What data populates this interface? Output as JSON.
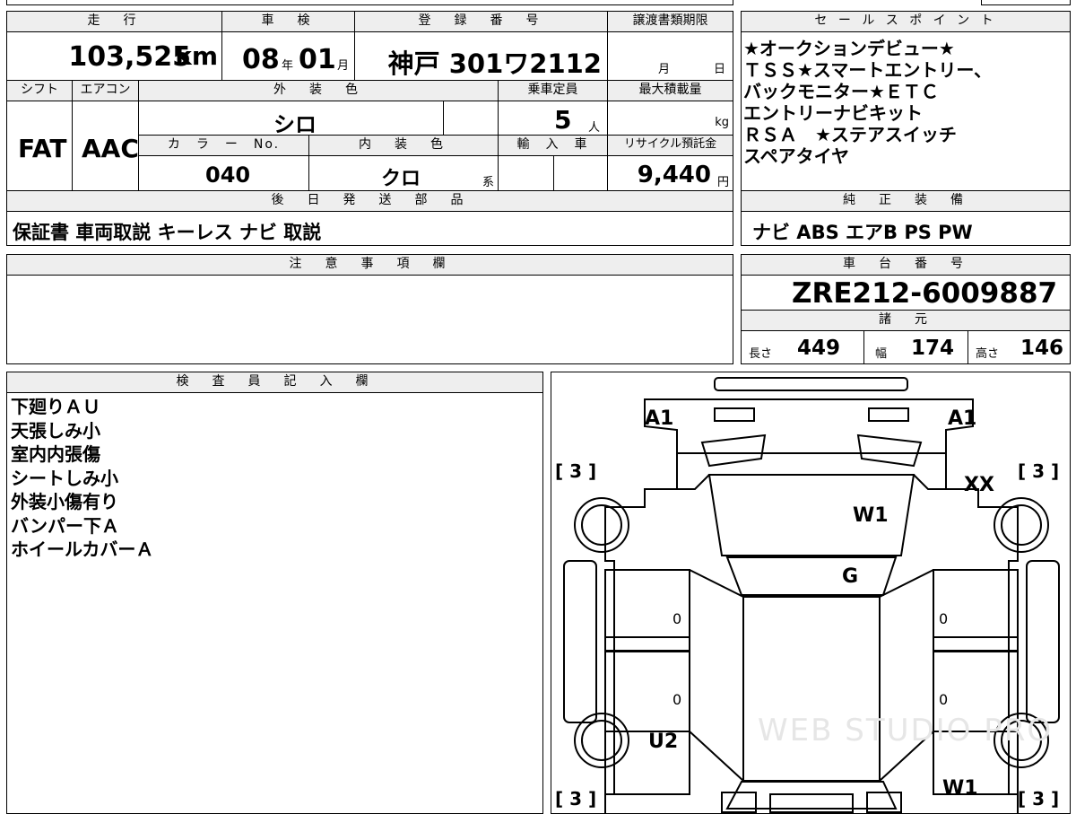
{
  "top_info": {
    "mileage_header": "走　行",
    "mileage_value": "103,525",
    "mileage_unit": "km",
    "inspection_header": "車　検",
    "inspection_year": "08",
    "inspection_year_unit": "年",
    "inspection_month": "01",
    "inspection_month_unit": "月",
    "registration_header": "登　録　番　号",
    "registration_value": "神戸 301ワ2112",
    "transfer_header": "譲渡書類期限",
    "transfer_month_unit": "月",
    "transfer_day_unit": "日",
    "shift_header": "シフト",
    "ac_header": "エアコン",
    "exterior_header": "外　装　色",
    "exterior_value": "シロ",
    "capacity_header": "乗車定員",
    "capacity_value": "5",
    "capacity_unit": "人",
    "max_load_header": "最大積載量",
    "max_load_unit": "kg",
    "shift_value": "FAT",
    "ac_value": "AAC",
    "color_no_header": "カ　ラ　ー　No.",
    "color_no_value": "040",
    "interior_header": "内　装　色",
    "interior_value": "クロ",
    "interior_suffix": "系",
    "import_header": "輸　入　車",
    "recycle_header": "リサイクル預託金",
    "recycle_value": "9,440",
    "recycle_unit": "円",
    "later_parts_header": "後　日　発　送　部　品",
    "later_parts_value": "保証書 車両取説 キーレス ナビ 取説"
  },
  "sales_points": {
    "header": "セ ー ル ス ポ イ ン ト",
    "lines": [
      "★オークションデビュー★",
      "ＴＳＳ★スマートエントリー、",
      "バックモニター★ＥＴＣ",
      "エントリーナビキット",
      "ＲＳＡ　★ステアスイッチ",
      "スペアタイヤ"
    ]
  },
  "genuine_equipment": {
    "header": "純　正　装　備",
    "value": "ナビ ABS エアB PS PW"
  },
  "notes": {
    "header": "注　意　事　項　欄"
  },
  "chassis": {
    "header": "車　台　番　号",
    "value": "ZRE212-6009887"
  },
  "specs": {
    "header": "諸　元",
    "length_label": "長さ",
    "length_value": "449",
    "width_label": "幅",
    "width_value": "174",
    "height_label": "高さ",
    "height_value": "146"
  },
  "inspector": {
    "header": "検　査　員　記　入　欄",
    "lines": [
      "下廻りＡＵ",
      "天張しみ小",
      "室内内張傷",
      "シートしみ小",
      "外装小傷有り",
      "バンパー下Ａ",
      "ホイールカバーＡ"
    ]
  },
  "diagram": {
    "marks": {
      "a1_left": "A1",
      "a1_right": "A1",
      "xx": "XX",
      "w1_hood": "W1",
      "g": "G",
      "u2": "U2",
      "w1_rear": "W1",
      "zero_1": "0",
      "zero_2": "0",
      "zero_3": "0",
      "zero_4": "0"
    },
    "tire_labels": {
      "front_left": "[ 3 ]",
      "front_right": "[ 3 ]",
      "rear_left": "[ 3 ]",
      "rear_right": "[ 3 ]"
    },
    "watermark": "WEB STUDIO PRO"
  }
}
